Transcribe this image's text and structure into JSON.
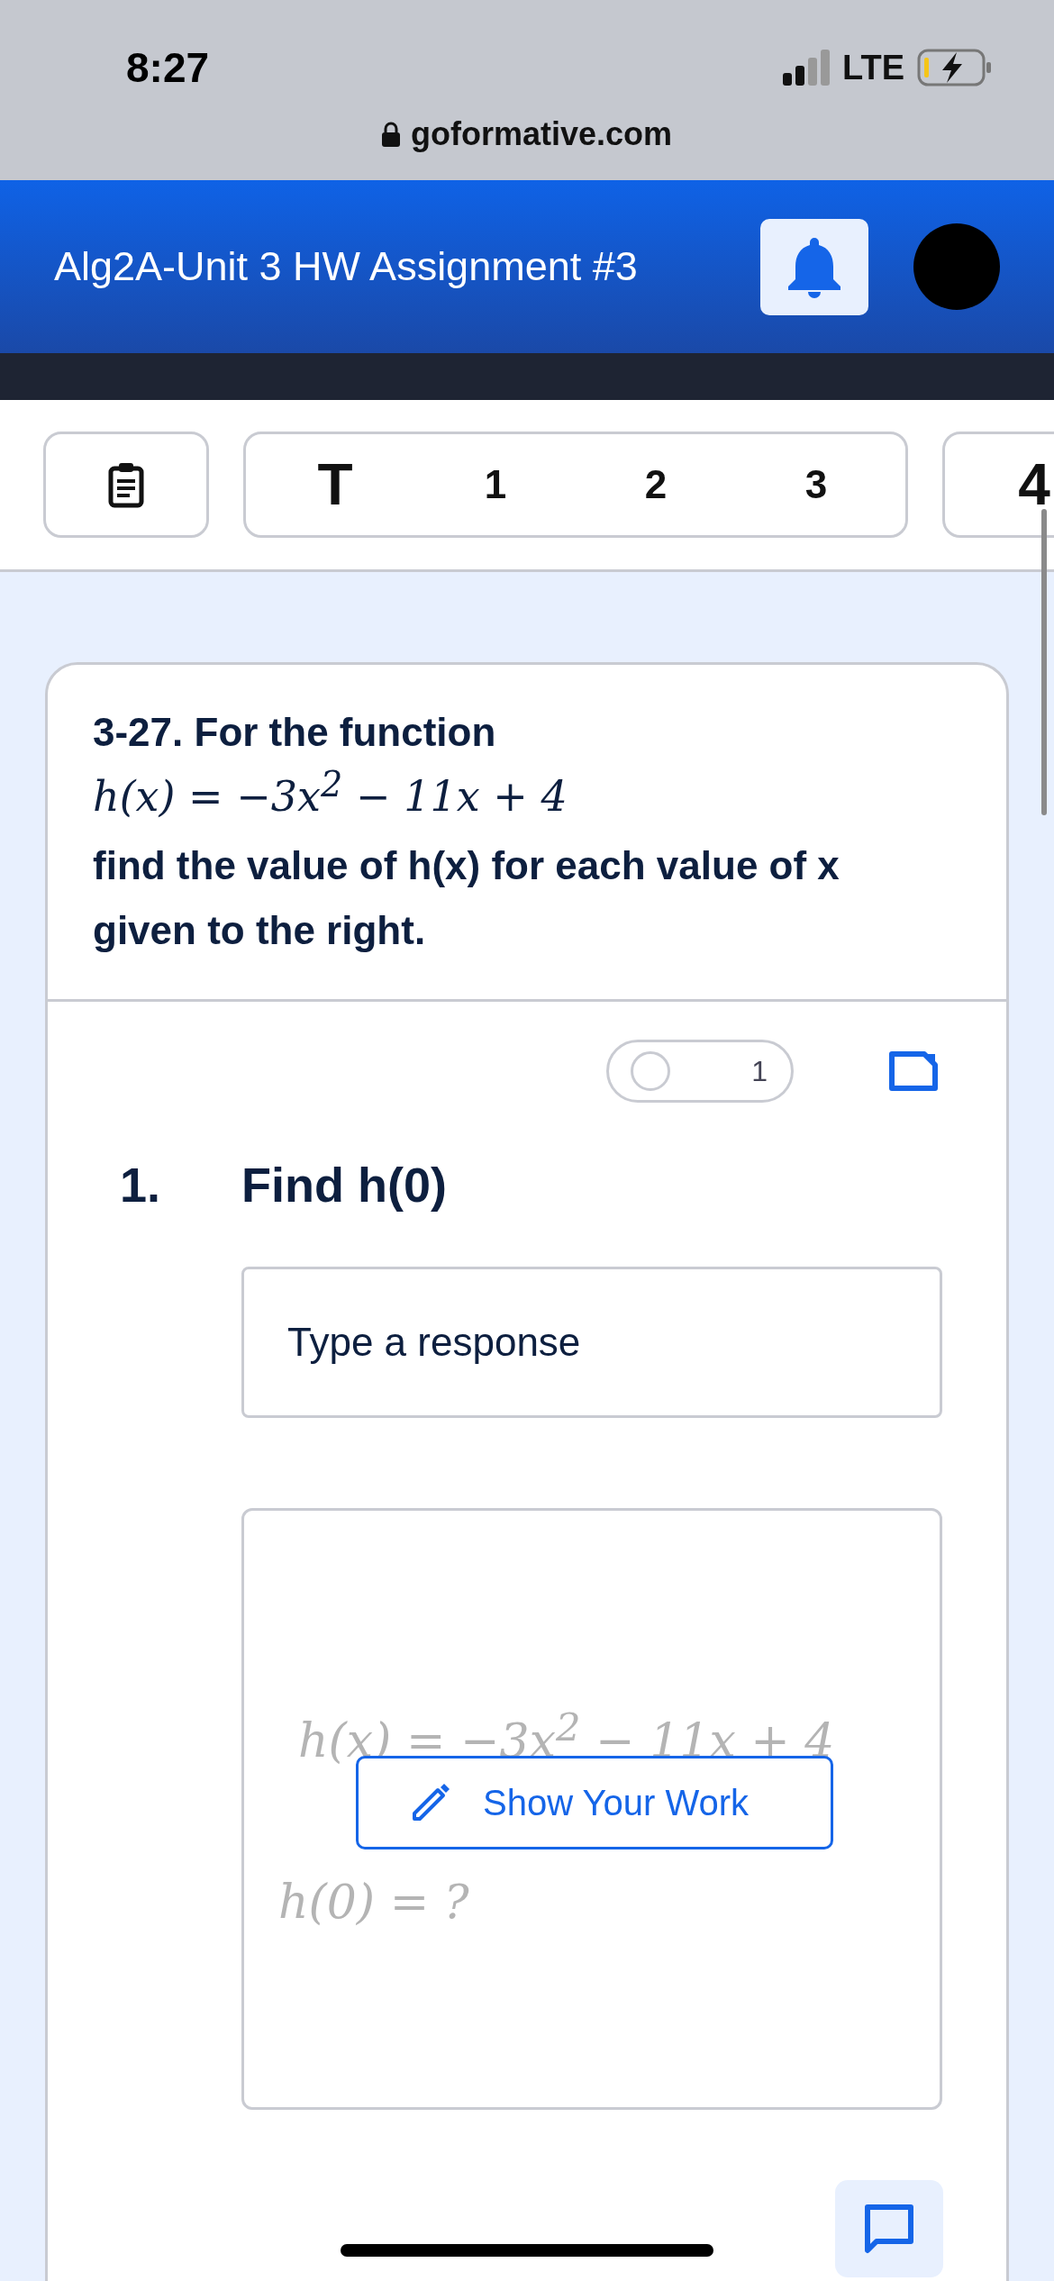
{
  "status_bar": {
    "time": "8:27",
    "network": "LTE"
  },
  "browser": {
    "url": "goformative.com"
  },
  "header": {
    "title": "Alg2A-Unit 3 HW Assignment #3"
  },
  "nav": {
    "overview": {
      "selected": false
    },
    "groups": [
      {
        "items": [
          {
            "label": "T",
            "selected": false
          },
          {
            "label": "1",
            "selected": false
          },
          {
            "label": "2",
            "selected": false
          },
          {
            "label": "3",
            "selected": false
          }
        ]
      },
      {
        "items": [
          {
            "label": "4",
            "selected": false
          }
        ]
      }
    ]
  },
  "question": {
    "title": "3-27. For the function",
    "formula": "h(x) = −3x$^{2}$ − 11x + 4",
    "text": "find the value of h(x) for each value of x given to the right."
  },
  "part": {
    "number": "1.",
    "prompt": "Find h(0)",
    "points_toggle": {
      "on": false,
      "count": "1"
    },
    "response": {
      "placeholder": "Type a response"
    },
    "work": {
      "preview": [
        "h(x) = −3x$^{2}$ − 11x + 4",
        "h(0) = ?"
      ],
      "button": "Show Your Work"
    }
  }
}
